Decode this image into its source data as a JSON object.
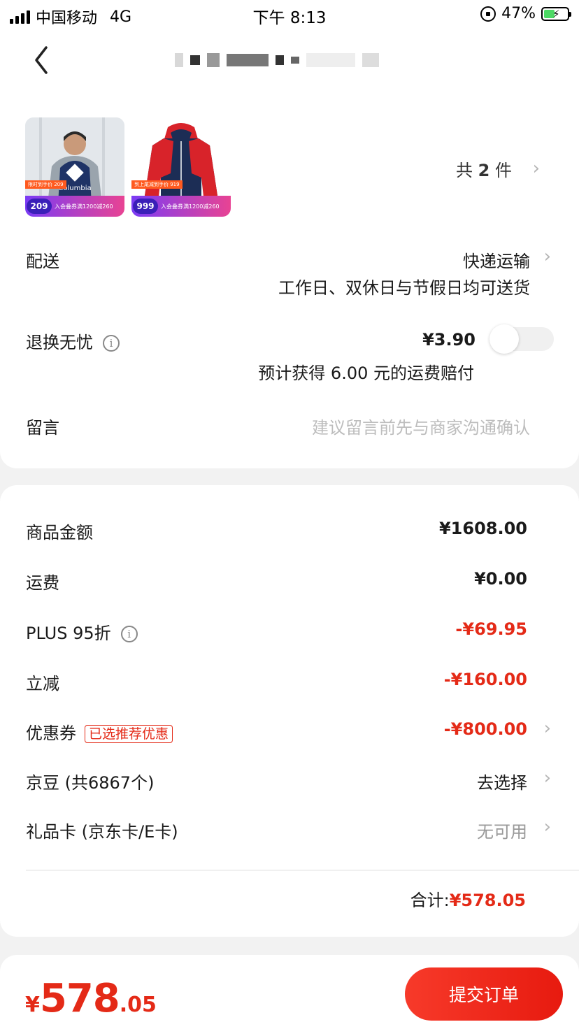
{
  "status_bar": {
    "carrier": "中国移动",
    "network": "4G",
    "time": "下午 8:13",
    "battery": "47%",
    "battery_level": 0.47
  },
  "header": {
    "back_icon": "chevron-left-icon",
    "title_redacted": true
  },
  "order_items": {
    "thumbnails": [
      {
        "brand_text": "Columbia",
        "price_badge": "209",
        "ribbon": "限时到手价 209",
        "promo": "入会叠券满1200减260"
      },
      {
        "price_badge": "999",
        "ribbon": "到上尾减到手价 919",
        "promo": "入会叠券满1200减260"
      }
    ],
    "count_prefix": "共",
    "count": "2",
    "count_suffix": "件"
  },
  "delivery": {
    "label": "配送",
    "method": "快递运输",
    "note": "工作日、双休日与节假日均可送货"
  },
  "return_insurance": {
    "label": "退换无忧",
    "price": "¥3.90",
    "note": "预计获得 6.00 元的运费赔付",
    "enabled": false
  },
  "message": {
    "label": "留言",
    "placeholder": "建议留言前先与商家沟通确认"
  },
  "summary": {
    "rows": [
      {
        "label": "商品金额",
        "value": "¥1608.00"
      },
      {
        "label": "运费",
        "value": "¥0.00"
      },
      {
        "label": "PLUS 95折",
        "value": "-¥69.95"
      },
      {
        "label": "立减",
        "value": "-¥160.00"
      },
      {
        "label": "优惠券",
        "tag": "已选推荐优惠",
        "value": "-¥800.00"
      },
      {
        "label": "京豆 (共6867个)",
        "value": "去选择"
      },
      {
        "label": "礼品卡 (京东卡/E卡)",
        "value": "无可用"
      }
    ],
    "total_label": "合计:",
    "total_value": "¥578.05"
  },
  "bottom_bar": {
    "currency": "¥",
    "price_int": "578",
    "price_dec": ".05",
    "submit_label": "提交订单"
  },
  "colors": {
    "accent": "#e42a17",
    "background": "#f2f2f2"
  }
}
